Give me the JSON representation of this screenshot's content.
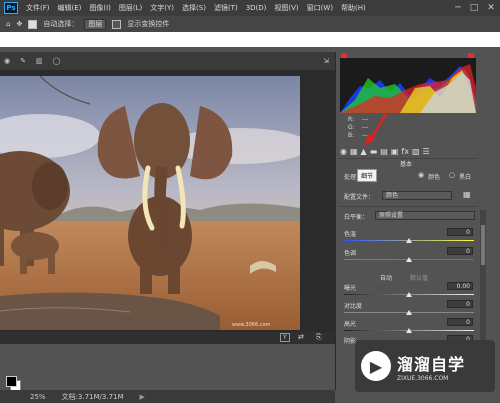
{
  "menubar": {
    "logo": "Ps",
    "items": [
      "文件(F)",
      "编辑(E)",
      "图像(I)",
      "图层(L)",
      "文字(Y)",
      "选择(S)",
      "滤镜(T)",
      "3D(D)",
      "视图(V)",
      "窗口(W)",
      "帮助(H)"
    ],
    "min": "─",
    "max": "□",
    "close": "✕"
  },
  "optionsbar": {
    "auto_select_label": "自动选择：",
    "auto_select_value": "图层",
    "transform_label": "显示变换控件"
  },
  "status": {
    "zoom": "25%",
    "doc": "文档:3.71M/3.71M"
  },
  "camera_raw": {
    "section": "基本",
    "treatment_label": "处理方式",
    "tooltip": "细节",
    "color_option": "颜色",
    "bw_option": "黑白",
    "profile_label": "配置文件：",
    "profile_value": "颜色",
    "wb_label": "白平衡：",
    "wb_value": "原照设置",
    "temp_label": "色温",
    "temp_value": "0",
    "tint_label": "色调",
    "tint_value": "0",
    "auto_label": "自动",
    "default_label": "默认值",
    "exposure_label": "曝光",
    "exposure_value": "0.00",
    "contrast_label": "对比度",
    "contrast_value": "0",
    "highlights_label": "高光",
    "highlights_value": "0",
    "shadows_label": "阴影",
    "shadows_value": "0",
    "rgb_r": "R:",
    "rgb_g": "G:",
    "rgb_b": "B:",
    "r_val": "---",
    "g_val": "---",
    "b_val": "---"
  },
  "photo": {
    "watermark_text": "www.3066.com"
  },
  "watermark": {
    "title": "溜溜自学",
    "sub": "ZIXUE.3066.COM"
  },
  "colors": {
    "accent": "#e03030",
    "panel": "#535353"
  }
}
